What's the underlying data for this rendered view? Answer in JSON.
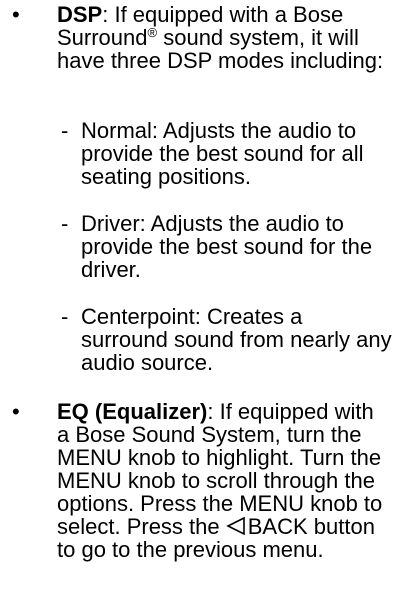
{
  "bullet_symbol": "•",
  "dash_symbol": "-",
  "dsp": {
    "term": "DSP",
    "intro_part1": ": If equipped with a Bose Surround",
    "registered_mark": "®",
    "intro_part2": " sound system, it will have three DSP modes including:",
    "modes": [
      {
        "text": "Normal: Adjusts the audio to provide the best sound for all seating positions."
      },
      {
        "text": "Driver: Adjusts the audio to provide the best sound for the driver."
      },
      {
        "text": "Centerpoint: Creates a surround sound from nearly any audio source."
      }
    ]
  },
  "eq": {
    "term": "EQ (Equalizer)",
    "text_part1": ": If equipped with a Bose Sound System, turn the MENU knob to highlight. Turn the MENU knob to scroll through the options. Press the MENU knob to select. Press the ",
    "back_icon": "back-triangle-icon",
    "text_part2": "BACK button to go to the previous menu."
  }
}
